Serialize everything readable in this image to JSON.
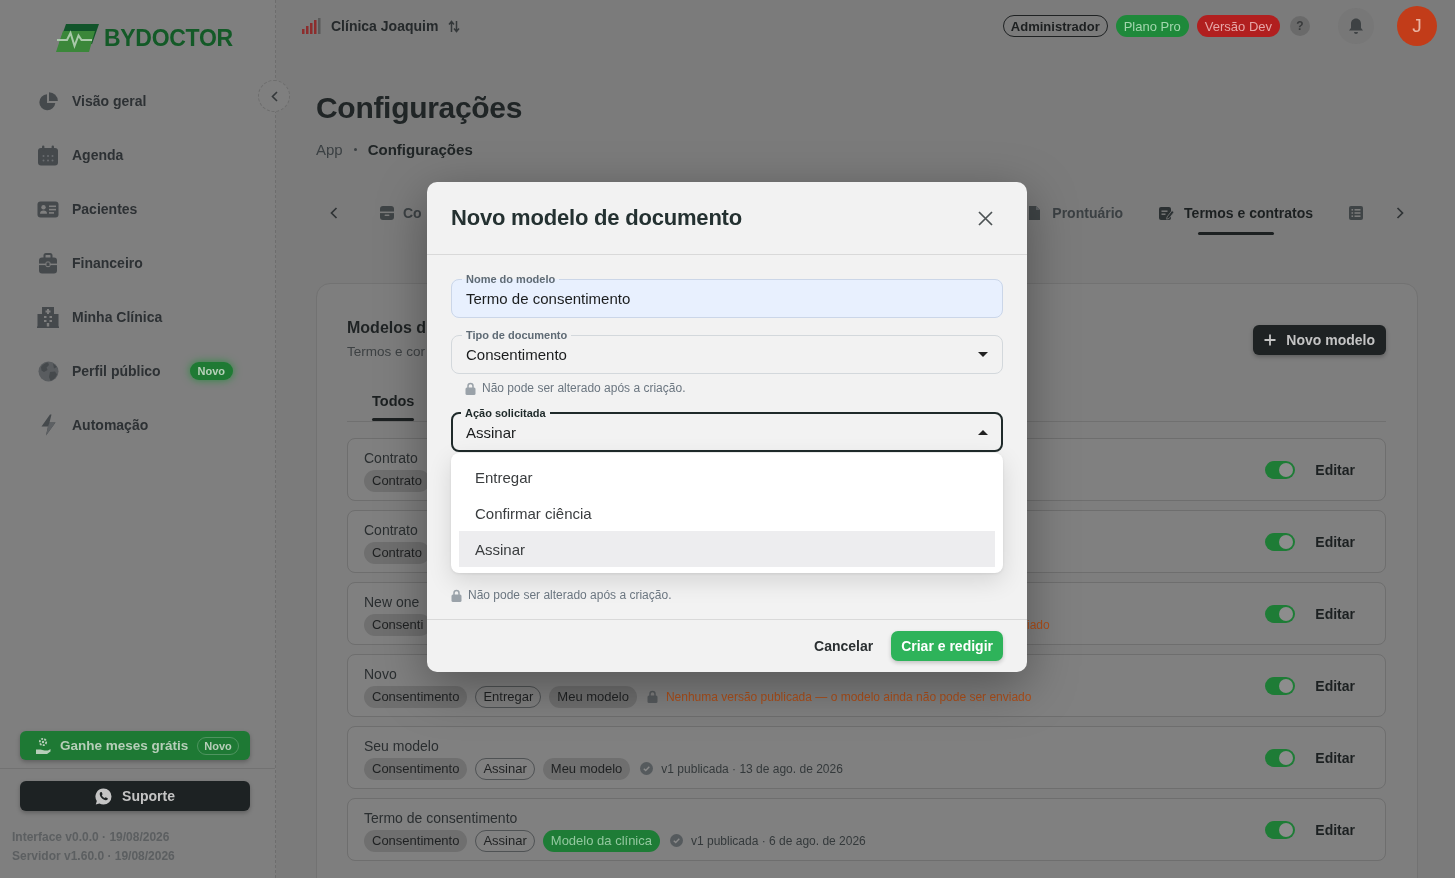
{
  "sidebar": {
    "logo": "BYDOCTOR",
    "items": [
      {
        "label": "Visão geral",
        "selected": false
      },
      {
        "label": "Agenda",
        "selected": false
      },
      {
        "label": "Pacientes",
        "selected": false
      },
      {
        "label": "Financeiro",
        "selected": false
      },
      {
        "label": "Minha Clínica",
        "selected": false
      },
      {
        "label": "Perfil público",
        "selected": false,
        "badge": "Novo"
      },
      {
        "label": "Automação",
        "selected": false
      }
    ],
    "promo": {
      "label": "Ganhe meses grátis",
      "badge": "Novo"
    },
    "support": "Suporte",
    "versions": [
      "Interface v0.0.0 · 19/08/2026",
      "Servidor v1.60.0 · 19/08/2026"
    ]
  },
  "topbar": {
    "clinic": "Clínica Joaquim",
    "badges": [
      {
        "label": "Administrador",
        "kind": "role"
      },
      {
        "label": "Plano Pro",
        "kind": "plan"
      },
      {
        "label": "Versão Dev",
        "kind": "env"
      }
    ],
    "help": "?",
    "avatar": "J"
  },
  "page": {
    "title": "Configurações",
    "breadcrumb": [
      "App",
      "Configurações"
    ],
    "tabs": [
      {
        "label": "Co",
        "selected": false
      },
      {
        "label": "Prontuário",
        "selected": false
      },
      {
        "label": "Termos e contratos",
        "selected": true
      },
      {
        "selected": false
      }
    ]
  },
  "panel": {
    "title": "Modelos d",
    "subtitle": "Termos e cor",
    "new_button": "Novo modelo",
    "filters": [
      {
        "label": "Todos",
        "selected": true
      }
    ],
    "rows": [
      {
        "title": "Contrato",
        "chips": [
          {
            "label": "Contrato",
            "kind": "type"
          }
        ],
        "on": true,
        "action": "Editar"
      },
      {
        "title": "Contrato",
        "chips": [
          {
            "label": "Contrato",
            "kind": "type"
          }
        ],
        "on": true,
        "action": "Editar"
      },
      {
        "title": "New one",
        "chips": [
          {
            "label": "Consenti",
            "kind": "type"
          }
        ],
        "status": {
          "kind": "draft",
          "text": "iado"
        },
        "on": true,
        "action": "Editar"
      },
      {
        "title": "Novo",
        "chips": [
          {
            "label": "Consentimento",
            "kind": "type"
          },
          {
            "label": "Entregar",
            "kind": "action"
          },
          {
            "label": "Meu modelo",
            "kind": "owner"
          }
        ],
        "status": {
          "kind": "draft",
          "text": "Nenhuma versão publicada — o modelo ainda não pode ser enviado"
        },
        "on": true,
        "action": "Editar"
      },
      {
        "title": "Seu modelo",
        "chips": [
          {
            "label": "Consentimento",
            "kind": "type"
          },
          {
            "label": "Assinar",
            "kind": "action"
          },
          {
            "label": "Meu modelo",
            "kind": "owner"
          }
        ],
        "status": {
          "kind": "published",
          "text": "v1 publicada · 13 de ago. de 2026"
        },
        "on": true,
        "action": "Editar"
      },
      {
        "title": "Termo de consentimento",
        "chips": [
          {
            "label": "Consentimento",
            "kind": "type"
          },
          {
            "label": "Assinar",
            "kind": "action"
          },
          {
            "label": "Modelo da clínica",
            "kind": "clinic"
          }
        ],
        "status": {
          "kind": "published",
          "text": "v1 publicada · 6 de ago. de 2026"
        },
        "on": true,
        "action": "Editar"
      }
    ]
  },
  "modal": {
    "title": "Novo modelo de documento",
    "fields": [
      {
        "label": "Nome do modelo",
        "value": "Termo de consentimento",
        "kind": "text",
        "autofilled": true,
        "focused": false
      },
      {
        "label": "Tipo de documento",
        "value": "Consentimento",
        "kind": "select",
        "autofilled": false,
        "focused": false,
        "expanded": false,
        "hint": "Não pode ser alterado após a criação."
      },
      {
        "label": "Ação solicitada",
        "value": "Assinar",
        "kind": "select",
        "autofilled": false,
        "focused": true,
        "expanded": true,
        "options": [
          {
            "label": "Entregar",
            "selected": false
          },
          {
            "label": "Confirmar ciência",
            "selected": false
          },
          {
            "label": "Assinar",
            "selected": true
          }
        ],
        "hint": "Não pode ser alterado após a criação."
      }
    ],
    "cancel": "Cancelar",
    "submit": "Criar e redigir"
  }
}
